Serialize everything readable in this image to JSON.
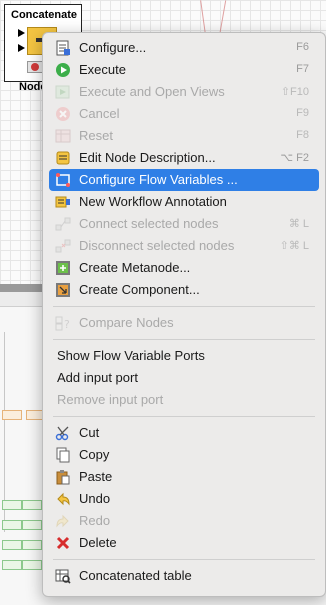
{
  "node": {
    "title": "Concatenate",
    "label": "Node"
  },
  "menu": {
    "groups": [
      [
        {
          "label": "Configure...",
          "shortcut": "F6",
          "icon": "configure-icon",
          "enabled": true
        },
        {
          "label": "Execute",
          "shortcut": "F7",
          "icon": "execute-icon",
          "enabled": true
        },
        {
          "label": "Execute and Open Views",
          "shortcut": "⇧F10",
          "icon": "execute-open-views-icon",
          "enabled": false
        },
        {
          "label": "Cancel",
          "shortcut": "F9",
          "icon": "cancel-icon",
          "enabled": false
        },
        {
          "label": "Reset",
          "shortcut": "F8",
          "icon": "reset-icon",
          "enabled": false
        },
        {
          "label": "Edit Node Description...",
          "shortcut": "⌥ F2",
          "icon": "edit-description-icon",
          "enabled": true
        },
        {
          "label": "Configure Flow Variables ...",
          "shortcut": "",
          "icon": "flow-variables-icon",
          "enabled": true,
          "selected": true
        },
        {
          "label": "New Workflow Annotation",
          "shortcut": "",
          "icon": "annotation-icon",
          "enabled": true
        },
        {
          "label": "Connect selected nodes",
          "shortcut": "⌘ L",
          "icon": "connect-icon",
          "enabled": false
        },
        {
          "label": "Disconnect selected nodes",
          "shortcut": "⇧⌘ L",
          "icon": "disconnect-icon",
          "enabled": false
        },
        {
          "label": "Create Metanode...",
          "shortcut": "",
          "icon": "metanode-icon",
          "enabled": true
        },
        {
          "label": "Create Component...",
          "shortcut": "",
          "icon": "component-icon",
          "enabled": true
        }
      ],
      [
        {
          "label": "Compare Nodes",
          "shortcut": "",
          "icon": "compare-icon",
          "enabled": false
        }
      ],
      [
        {
          "label": "Show Flow Variable Ports",
          "shortcut": "",
          "icon": "",
          "enabled": true
        },
        {
          "label": "Add input port",
          "shortcut": "",
          "icon": "",
          "enabled": true
        },
        {
          "label": "Remove input port",
          "shortcut": "",
          "icon": "",
          "enabled": false
        }
      ],
      [
        {
          "label": "Cut",
          "shortcut": "",
          "icon": "cut-icon",
          "enabled": true
        },
        {
          "label": "Copy",
          "shortcut": "",
          "icon": "copy-icon",
          "enabled": true
        },
        {
          "label": "Paste",
          "shortcut": "",
          "icon": "paste-icon",
          "enabled": true
        },
        {
          "label": "Undo",
          "shortcut": "",
          "icon": "undo-icon",
          "enabled": true
        },
        {
          "label": "Redo",
          "shortcut": "",
          "icon": "redo-icon",
          "enabled": false
        },
        {
          "label": "Delete",
          "shortcut": "",
          "icon": "delete-icon",
          "enabled": true
        }
      ],
      [
        {
          "label": "Concatenated table",
          "shortcut": "",
          "icon": "table-view-icon",
          "enabled": true
        }
      ]
    ]
  },
  "colors": {
    "selection": "#2f7fe6",
    "node_color": "#f4c542",
    "status_red": "#d23b3b"
  }
}
